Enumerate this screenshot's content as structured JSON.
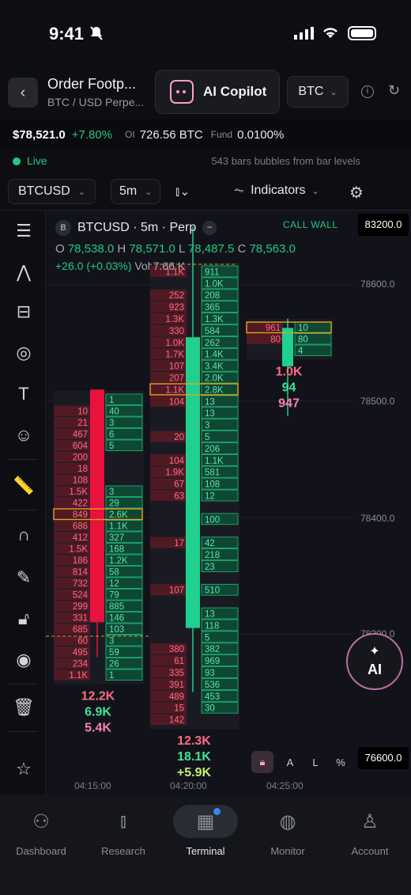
{
  "status": {
    "time": "9:41"
  },
  "header": {
    "title": "Order Footp...",
    "subtitle": "BTC / USD Perpe...",
    "copilot_label": "AI Copilot",
    "coin": "BTC"
  },
  "ticker": {
    "price": "$78,521.0",
    "change": "+7.80%",
    "oi_label": "OI",
    "oi_value": "726.56 BTC",
    "fund_label": "Fund",
    "fund_value": "0.0100%"
  },
  "live": {
    "label": "Live",
    "meta": "543 bars  bubbles from bar levels"
  },
  "toolbar": {
    "symbol": "BTCUSD",
    "interval": "5m",
    "indicators": "Indicators"
  },
  "chart": {
    "badge": "B",
    "title": "BTCUSD · 5m · Perp",
    "o_label": "O",
    "o": "78,538.0",
    "h_label": "H",
    "h": "78,571.0",
    "l_label": "L",
    "l": "78,487.5",
    "c_label": "C",
    "c": "78,563.0",
    "change": "+26.0 (+0.03%)",
    "vol": "Vol 7.66 K",
    "call_wall": "CALL WALL",
    "axis_top_box": "83200.0",
    "axis_bottom_box": "76600.0",
    "axis_labels": [
      "78600.0",
      "78500.0",
      "78400.0",
      "78300.0"
    ],
    "time_labels": [
      "04:15:00",
      "04:20:00",
      "04:25:00"
    ]
  },
  "chart_data": {
    "type": "footprint",
    "title": "BTCUSD · 5m · Perp",
    "price_range": [
      78250,
      78650
    ],
    "candles": [
      {
        "time": "04:15:00",
        "direction": "down",
        "open": 78510,
        "close": 78310,
        "high": 78510,
        "low": 78280,
        "totals": [
          "12.2K",
          "6.9K",
          "5.4K"
        ],
        "rows": [
          [
            "",
            "1"
          ],
          [
            "10",
            "40"
          ],
          [
            "21",
            "3"
          ],
          [
            "467",
            "6"
          ],
          [
            "604",
            "5"
          ],
          [
            "200",
            ""
          ],
          [
            "18",
            ""
          ],
          [
            "108",
            ""
          ],
          [
            "1.5K",
            "3"
          ],
          [
            "422",
            "29"
          ],
          [
            "849",
            "2.6K"
          ],
          [
            "686",
            "1.1K"
          ],
          [
            "412",
            "327"
          ],
          [
            "1.5K",
            "168"
          ],
          [
            "186",
            "1.2K"
          ],
          [
            "814",
            "58"
          ],
          [
            "732",
            "12"
          ],
          [
            "524",
            "79"
          ],
          [
            "299",
            "885"
          ],
          [
            "331",
            "146"
          ],
          [
            "685",
            "103"
          ],
          [
            "60",
            "3"
          ],
          [
            "495",
            "59"
          ],
          [
            "234",
            "26"
          ],
          [
            "1.1K",
            "1"
          ]
        ]
      },
      {
        "time": "04:20:00",
        "direction": "up",
        "open": 78305,
        "close": 78555,
        "high": 78650,
        "low": 78250,
        "totals": [
          "12.3K",
          "18.1K",
          "+5.9K"
        ],
        "rows": [
          [
            "1.1K",
            "911"
          ],
          [
            "",
            "1.0K"
          ],
          [
            "252",
            "208"
          ],
          [
            "923",
            "365"
          ],
          [
            "1.3K",
            "1.3K"
          ],
          [
            "330",
            "584"
          ],
          [
            "1.0K",
            "262"
          ],
          [
            "1.7K",
            "1.4K"
          ],
          [
            "107",
            "3.4K"
          ],
          [
            "207",
            "2.0K"
          ],
          [
            "1.1K",
            "2.8K"
          ],
          [
            "104",
            "13"
          ],
          [
            "",
            "13"
          ],
          [
            "",
            "3"
          ],
          [
            "20",
            "5"
          ],
          [
            "",
            "206"
          ],
          [
            "104",
            "1.1K"
          ],
          [
            "1.9K",
            "581"
          ],
          [
            "67",
            "108"
          ],
          [
            "63",
            "12"
          ],
          [
            "",
            ""
          ],
          [
            "",
            "100"
          ],
          [
            "",
            ""
          ],
          [
            "17",
            "42"
          ],
          [
            "",
            "218"
          ],
          [
            "",
            "23"
          ],
          [
            "",
            ""
          ],
          [
            "107",
            "510"
          ],
          [
            "",
            ""
          ],
          [
            "",
            "13"
          ],
          [
            "",
            "118"
          ],
          [
            "",
            "5"
          ],
          [
            "380",
            "382"
          ],
          [
            "61",
            "969"
          ],
          [
            "335",
            "93"
          ],
          [
            "391",
            "536"
          ],
          [
            "489",
            "453"
          ],
          [
            "15",
            "30"
          ],
          [
            "142",
            ""
          ]
        ]
      },
      {
        "time": "04:25:00",
        "direction": "up",
        "open": 78530,
        "close": 78563,
        "high": 78571,
        "low": 78487.5,
        "totals": [
          "1.0K",
          "94",
          "947"
        ],
        "rows": [
          [
            "961",
            "10"
          ],
          [
            "80",
            "80"
          ],
          [
            "",
            "4"
          ]
        ]
      }
    ]
  },
  "ai_button": {
    "label": "AI"
  },
  "scale_opts": [
    "A",
    "L",
    "%"
  ],
  "tabs": [
    {
      "label": "Dashboard"
    },
    {
      "label": "Research"
    },
    {
      "label": "Terminal"
    },
    {
      "label": "Monitor"
    },
    {
      "label": "Account"
    }
  ]
}
